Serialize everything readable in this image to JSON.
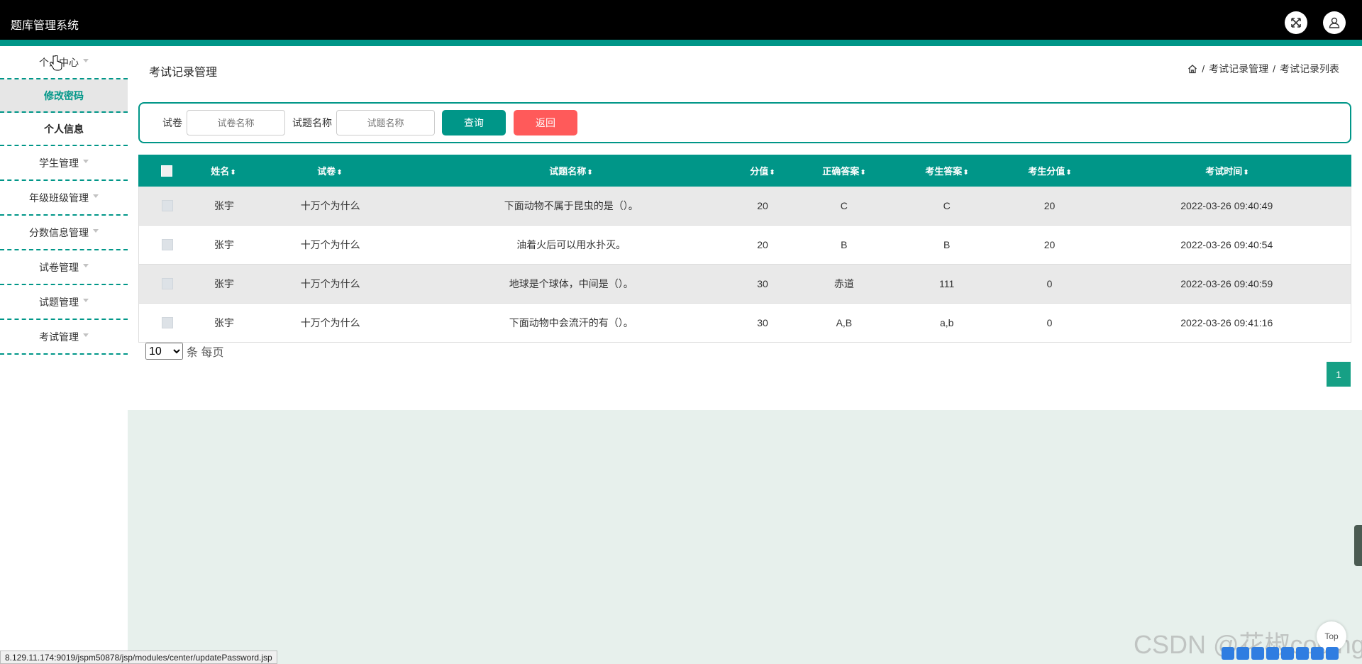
{
  "header": {
    "title": "题库管理系统",
    "fullscreen_icon": "expand-icon",
    "user_icon": "user-icon"
  },
  "sidebar": {
    "items": [
      {
        "label": "个人中心",
        "expanded": true
      },
      {
        "label": "学生管理"
      },
      {
        "label": "年级班级管理"
      },
      {
        "label": "分数信息管理"
      },
      {
        "label": "试卷管理"
      },
      {
        "label": "试题管理"
      },
      {
        "label": "考试管理"
      }
    ],
    "subitems": [
      {
        "label": "修改密码",
        "active": true
      },
      {
        "label": "个人信息",
        "active": false
      }
    ]
  },
  "page": {
    "title": "考试记录管理",
    "breadcrumb": [
      "考试记录管理",
      "考试记录列表"
    ],
    "separator": "/"
  },
  "search": {
    "paper_label": "试卷",
    "paper_placeholder": "试卷名称",
    "question_label": "试题名称",
    "question_placeholder": "试题名称",
    "query_label": "查询",
    "back_label": "返回"
  },
  "table": {
    "headers": [
      "姓名",
      "试卷",
      "试题名称",
      "分值",
      "正确答案",
      "考生答案",
      "考生分值",
      "考试时间"
    ],
    "sort_glyph": "⬍",
    "rows": [
      [
        "张宇",
        "十万个为什么",
        "下面动物不属于昆虫的是（）。",
        "20",
        "C",
        "C",
        "20",
        "2022-03-26 09:40:49"
      ],
      [
        "张宇",
        "十万个为什么",
        "油着火后可以用水扑灭。",
        "20",
        "B",
        "B",
        "20",
        "2022-03-26 09:40:54"
      ],
      [
        "张宇",
        "十万个为什么",
        "地球是个球体，中间是（）。",
        "30",
        "赤道",
        "111",
        "0",
        "2022-03-26 09:40:59"
      ],
      [
        "张宇",
        "十万个为什么",
        "下面动物中会流汗的有（）。",
        "30",
        "A,B",
        "a,b",
        "0",
        "2022-03-26 09:41:16"
      ]
    ]
  },
  "pagination": {
    "page_size": "10",
    "page_size_suffix": "条 每页",
    "current_page": "1"
  },
  "statusbar": {
    "url": "8.129.11.174:9019/jspm50878/jsp/modules/center/updatePassword.jsp"
  },
  "overlay": {
    "watermark": "CSDN @花椒coding",
    "top_button": "Top"
  },
  "colors": {
    "accent": "#009688",
    "danger": "#ff5a5a",
    "header_bg": "#000000"
  }
}
